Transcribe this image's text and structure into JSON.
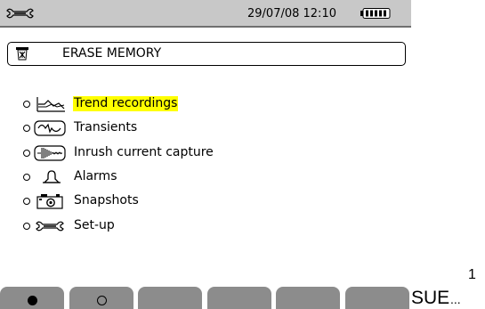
{
  "status_bar": {
    "tool_icon": "wrench-icon",
    "datetime": "29/07/08 12:10",
    "battery_icon": "battery-full-icon"
  },
  "header": {
    "icon": "trash-icon",
    "title": "ERASE MEMORY"
  },
  "menu": {
    "items": [
      {
        "label": "Trend recordings",
        "icon": "trend-icon",
        "selected": true
      },
      {
        "label": "Transients",
        "icon": "transient-wave-icon",
        "selected": false
      },
      {
        "label": "Inrush current capture",
        "icon": "inrush-icon",
        "selected": false
      },
      {
        "label": "Alarms",
        "icon": "bell-icon",
        "selected": false
      },
      {
        "label": "Snapshots",
        "icon": "camera-icon",
        "selected": false
      },
      {
        "label": "Set-up",
        "icon": "wrench-icon",
        "selected": false
      }
    ]
  },
  "softkeys": [
    {
      "icon": "filled-circle-icon"
    },
    {
      "icon": "hollow-circle-icon"
    },
    {
      "icon": ""
    },
    {
      "icon": ""
    },
    {
      "icon": ""
    },
    {
      "icon": ""
    }
  ],
  "external": {
    "label": "SUE",
    "ellipsis": "...",
    "superscript": "1"
  },
  "colors": {
    "status_bar_bg": "#c8c8c8",
    "softkey_bg": "#8c8c8c",
    "highlight": "#ffff00"
  }
}
